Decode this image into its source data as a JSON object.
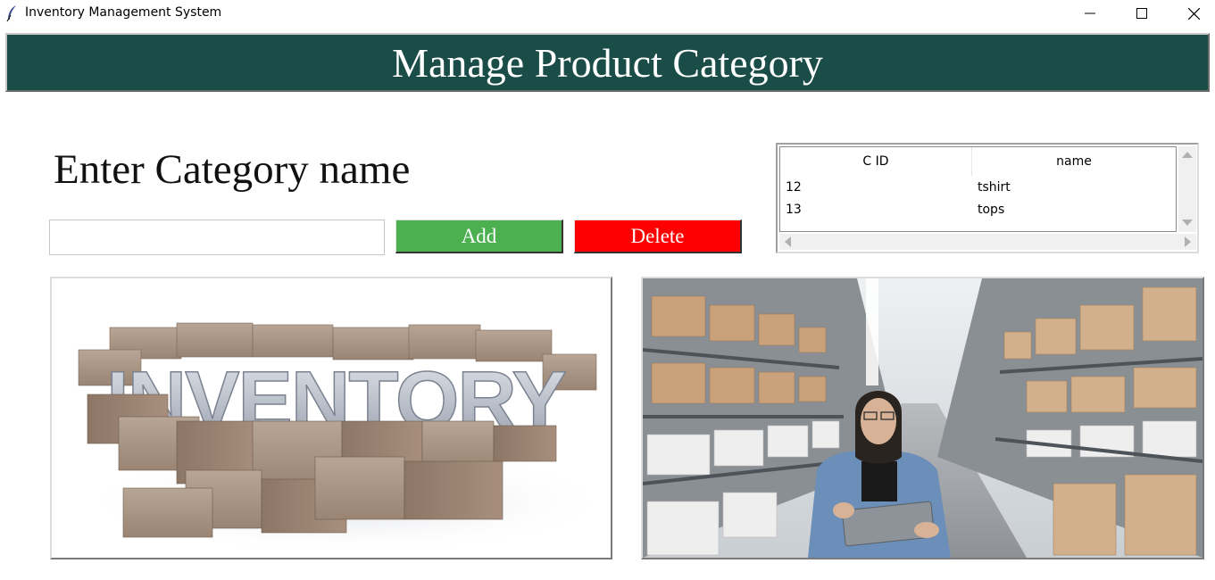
{
  "window": {
    "title": "Inventory Management System",
    "icon": "feather-icon",
    "controls": [
      "minimize-icon",
      "maximize-icon",
      "close-icon"
    ]
  },
  "header": {
    "title": "Manage Product Category",
    "background": "#1a4d47"
  },
  "form": {
    "label": "Enter Category name",
    "input_value": "",
    "add_label": "Add",
    "delete_label": "Delete",
    "add_color": "#4caf50",
    "delete_color": "#ff0000"
  },
  "table": {
    "columns": [
      "C ID",
      "name"
    ],
    "rows": [
      [
        "12",
        "tshirt"
      ],
      [
        "13",
        "tops"
      ]
    ]
  },
  "images": {
    "left": "inventory-boxes-image",
    "left_text": "INVENTORY",
    "right": "warehouse-worker-image"
  }
}
